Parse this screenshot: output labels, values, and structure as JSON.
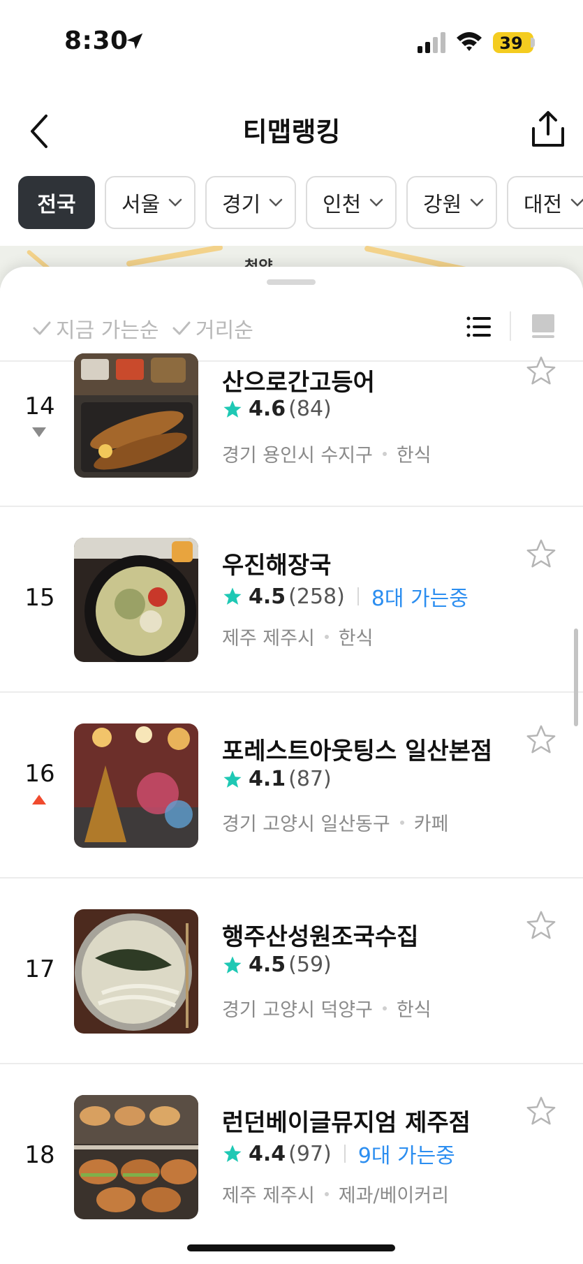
{
  "status_bar": {
    "time": "8:30",
    "battery": "39"
  },
  "header": {
    "title": "티맵랭킹"
  },
  "regions": [
    {
      "label": "전국",
      "active": true
    },
    {
      "label": "서울"
    },
    {
      "label": "경기"
    },
    {
      "label": "인천"
    },
    {
      "label": "강원"
    },
    {
      "label": "대전"
    }
  ],
  "map": {
    "label": "청양"
  },
  "sort": {
    "open_now": "지금 가는순",
    "distance": "거리순"
  },
  "items": [
    {
      "rank": "14",
      "name": "산으로간고등어",
      "score": "4.6",
      "count": "(84)",
      "live": "",
      "location": "경기 용인시 수지구",
      "category": "한식",
      "change": "down"
    },
    {
      "rank": "15",
      "name": "우진해장국",
      "score": "4.5",
      "count": "(258)",
      "live": "8대 가는중",
      "location": "제주 제주시",
      "category": "한식",
      "change": ""
    },
    {
      "rank": "16",
      "name": "포레스트아웃팅스 일산본점",
      "score": "4.1",
      "count": "(87)",
      "live": "",
      "location": "경기 고양시 일산동구",
      "category": "카페",
      "change": "up"
    },
    {
      "rank": "17",
      "name": "행주산성원조국수집",
      "score": "4.5",
      "count": "(59)",
      "live": "",
      "location": "경기 고양시 덕양구",
      "category": "한식",
      "change": ""
    },
    {
      "rank": "18",
      "name": "런던베이글뮤지엄 제주점",
      "score": "4.4",
      "count": "(97)",
      "live": "9대 가는중",
      "location": "제주 제주시",
      "category": "제과/베이커리",
      "change": ""
    }
  ],
  "colors": {
    "accent_star": "#1ec8b4",
    "live_blue": "#2c8ef0",
    "rank_up": "#f04a2e",
    "rank_down": "#8a8a8a",
    "active_chip": "#2f3338"
  }
}
